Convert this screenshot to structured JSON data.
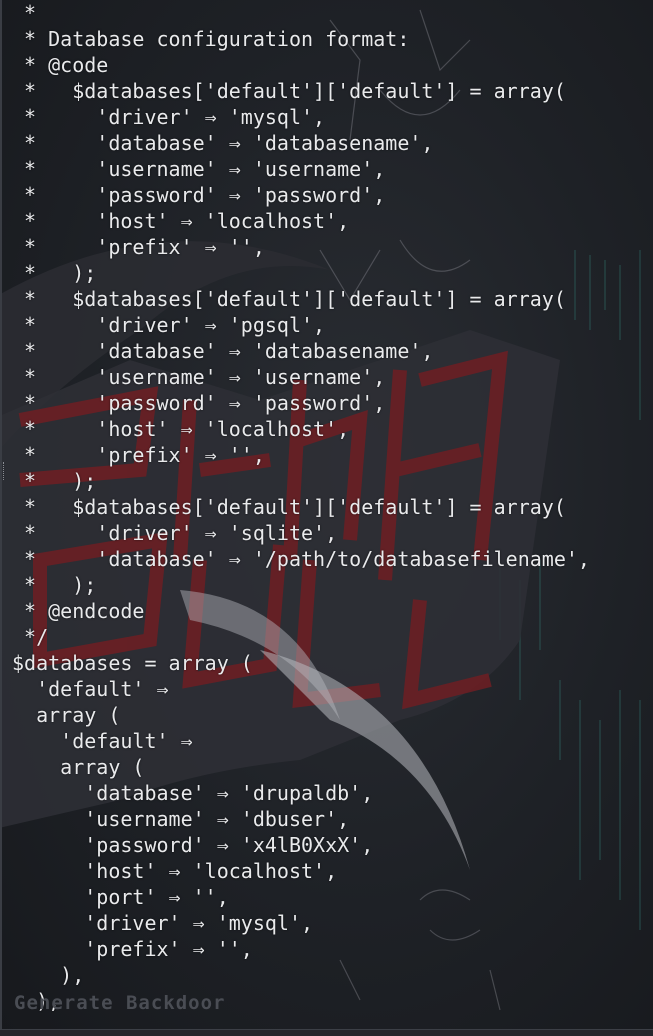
{
  "editor": {
    "lines": [
      " *",
      " * Database configuration format:",
      " * @code",
      " *   $databases['default']['default'] = array(",
      " *     'driver' ⇒ 'mysql',",
      " *     'database' ⇒ 'databasename',",
      " *     'username' ⇒ 'username',",
      " *     'password' ⇒ 'password',",
      " *     'host' ⇒ 'localhost',",
      " *     'prefix' ⇒ '',",
      " *   );",
      " *   $databases['default']['default'] = array(",
      " *     'driver' ⇒ 'pgsql',",
      " *     'database' ⇒ 'databasename',",
      " *     'username' ⇒ 'username',",
      " *     'password' ⇒ 'password',",
      " *     'host' ⇒ 'localhost',",
      " *     'prefix' ⇒ '',",
      " *   );",
      " *   $databases['default']['default'] = array(",
      " *     'driver' ⇒ 'sqlite',",
      " *     'database' ⇒ '/path/to/databasefilename',",
      " *   );",
      " * @endcode",
      " */",
      "$databases = array (",
      "  'default' ⇒",
      "  array (",
      "    'default' ⇒",
      "    array (",
      "      'database' ⇒ 'drupaldb',",
      "      'username' ⇒ 'dbuser',",
      "      'password' ⇒ 'x4lB0XxX',",
      "      'host' ⇒ 'localhost',",
      "      'port' ⇒ '',",
      "      'driver' ⇒ 'mysql',",
      "      'prefix' ⇒ '',",
      "    ),",
      "  ),"
    ],
    "status_text": "Generate Backdoor"
  },
  "theme": {
    "text_color": "#e9eaec",
    "background": "#1e2126",
    "logo_red": "#6b1f24",
    "matrix_color": "#2f5d5a"
  }
}
